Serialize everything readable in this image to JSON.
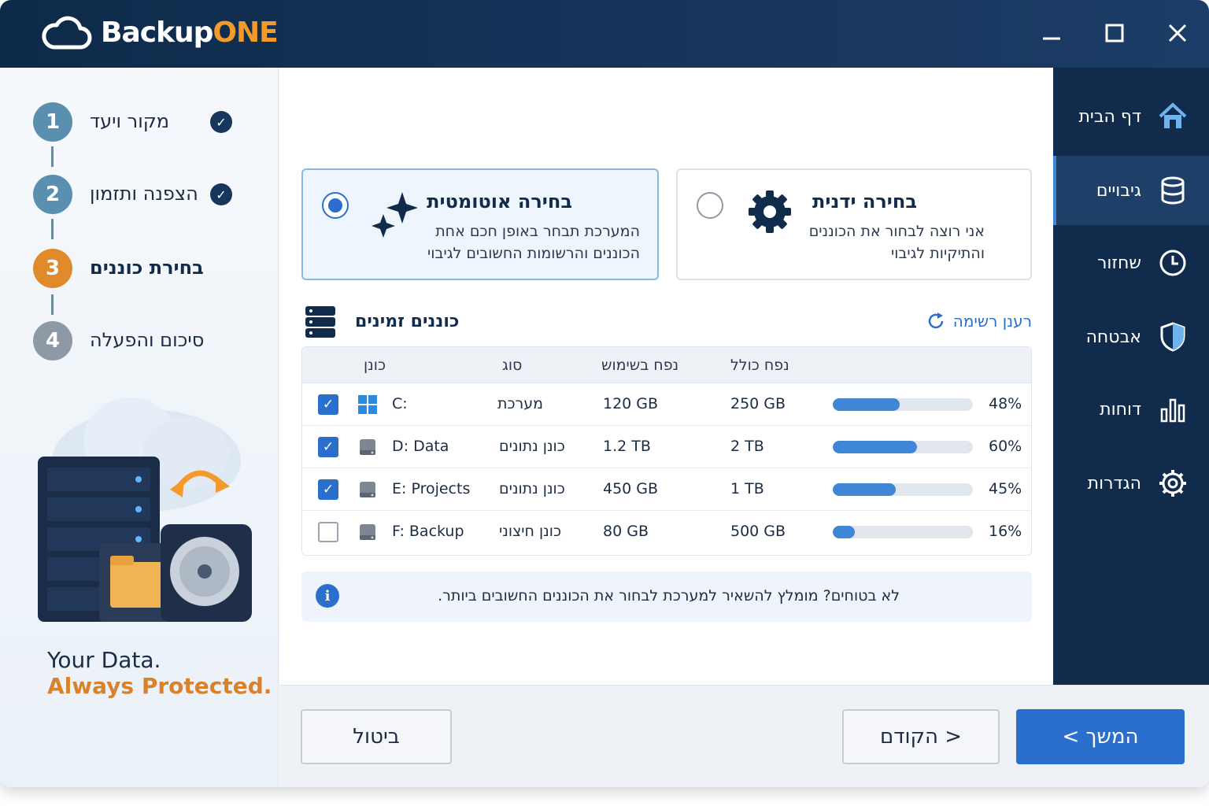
{
  "app": {
    "logo_main": "Backup",
    "logo_accent": "ONE"
  },
  "window_controls": {
    "minimize": "—",
    "maximize": "☐",
    "close": "✕"
  },
  "steps": [
    {
      "number": "1",
      "label": "מקור ויעד",
      "status": "done"
    },
    {
      "number": "2",
      "label": "הצפנה ותזמון",
      "status": "done"
    },
    {
      "number": "3",
      "label": "בחירת כוננים",
      "status": "current"
    },
    {
      "number": "4",
      "label": "סיכום והפעלה",
      "status": "pending"
    }
  ],
  "tagline": {
    "line1": "Your Data.",
    "line2": "Always Protected."
  },
  "nav": [
    {
      "label": "דף הבית",
      "icon": "home-icon"
    },
    {
      "label": "גיבויים",
      "icon": "database-icon",
      "active": true
    },
    {
      "label": "שחזור",
      "icon": "clock-icon"
    },
    {
      "label": "אבטחה",
      "icon": "shield-icon"
    },
    {
      "label": "דוחות",
      "icon": "bar-chart-icon"
    },
    {
      "label": "הגדרות",
      "icon": "gear-icon"
    }
  ],
  "options": {
    "auto": {
      "title": "בחירה אוטומטית",
      "desc1": "המערכת תבחר באופן חכם אחת",
      "desc2": "הכוננים והרשומות החשובים לגיבוי",
      "selected": true
    },
    "manual": {
      "title": "בחירה ידנית",
      "desc1": "אני רוצה לבחור את הכוננים",
      "desc2": "והתיקיות לגיבוי",
      "selected": false
    }
  },
  "drives_section": {
    "title": "כוננים זמינים",
    "refresh": "רענן רשימה"
  },
  "table": {
    "headers": {
      "drive": "כונן",
      "type": "סוג",
      "used": "נפח בשימוש",
      "total": "נפח כולל"
    },
    "rows": [
      {
        "drive": "C:",
        "type": "מערכת",
        "used": "120 GB",
        "total": "250 GB",
        "percent": "48%",
        "fill": 48,
        "checked": true,
        "icon": "windows-icon"
      },
      {
        "drive": "D: Data",
        "type": "כונן נתונים",
        "used": "1.2 TB",
        "total": "2 TB",
        "percent": "60%",
        "fill": 60,
        "checked": true,
        "icon": "hard-drive-icon"
      },
      {
        "drive": "E: Projects",
        "type": "כונן נתונים",
        "used": "450 GB",
        "total": "1 TB",
        "percent": "45%",
        "fill": 45,
        "checked": true,
        "icon": "hard-drive-icon"
      },
      {
        "drive": "F: Backup",
        "type": "כונן חיצוני",
        "used": "80 GB",
        "total": "500 GB",
        "percent": "16%",
        "fill": 16,
        "checked": false,
        "icon": "hard-drive-icon"
      }
    ]
  },
  "info": {
    "text": "לא בטוחים? מומלץ להשאיר למערכת לבחור את הכוננים החשובים ביותר.",
    "icon_glyph": "i"
  },
  "buttons": {
    "cancel": "ביטול",
    "back": "< הקודם",
    "next": "המשך >"
  },
  "colors": {
    "accent": "#2a6fcb",
    "brand_dark": "#102b4c",
    "brand_orange": "#f39a2b",
    "step_current": "#e08a2c",
    "step_done": "#5a8fb0",
    "step_pending": "#8e99a6"
  }
}
